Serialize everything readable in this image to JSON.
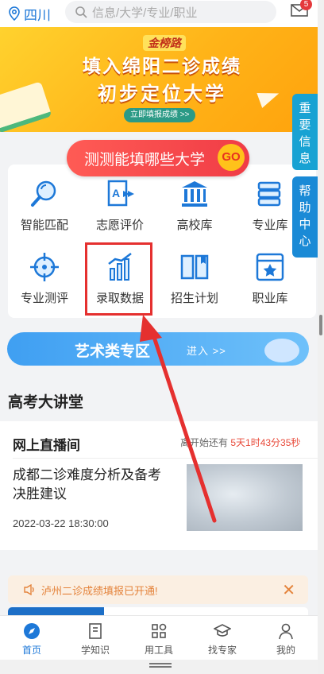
{
  "header": {
    "location": "四川",
    "search_placeholder": "信息/大学/专业/职业",
    "mail_badge": "5"
  },
  "banner": {
    "logo": "金榜路",
    "line1": "填入绵阳二诊成绩",
    "line2": "初步定位大学",
    "cta": "立即填报成绩 >>"
  },
  "side": {
    "info": "重要信息",
    "help": "帮助中心"
  },
  "test": {
    "label": "测测能填哪些大学",
    "go": "GO"
  },
  "grid": [
    {
      "label": "智能匹配",
      "icon": "magnifier-icon"
    },
    {
      "label": "志愿评价",
      "icon": "document-a-icon"
    },
    {
      "label": "高校库",
      "icon": "university-icon"
    },
    {
      "label": "专业库",
      "icon": "books-icon"
    },
    {
      "label": "专业测评",
      "icon": "target-icon"
    },
    {
      "label": "录取数据",
      "icon": "bar-chart-icon"
    },
    {
      "label": "招生计划",
      "icon": "open-book-icon"
    },
    {
      "label": "职业库",
      "icon": "browser-star-icon"
    }
  ],
  "art": {
    "title": "艺术类专区",
    "enter": "进入 >>"
  },
  "section": {
    "title": "高考大讲堂"
  },
  "live": {
    "heading": "网上直播间",
    "countdown_prefix": "离开始还有",
    "countdown": "5天1时43分35秒",
    "title": "成都二诊难度分析及备考决胜建议",
    "time": "2022-03-22 18:30:00"
  },
  "notice": {
    "text": "泸州二诊成绩填报已开通!",
    "close": "✕"
  },
  "progress": {
    "fraction": 0.32
  },
  "tabs": [
    {
      "label": "首页",
      "icon": "compass-icon"
    },
    {
      "label": "学知识",
      "icon": "notebook-icon"
    },
    {
      "label": "用工具",
      "icon": "tools-icon"
    },
    {
      "label": "找专家",
      "icon": "graduation-cap-icon"
    },
    {
      "label": "我的",
      "icon": "user-icon"
    }
  ],
  "colors": {
    "brand": "#1d78d8",
    "highlight": "#e5302f",
    "banner": "#ffb318"
  }
}
